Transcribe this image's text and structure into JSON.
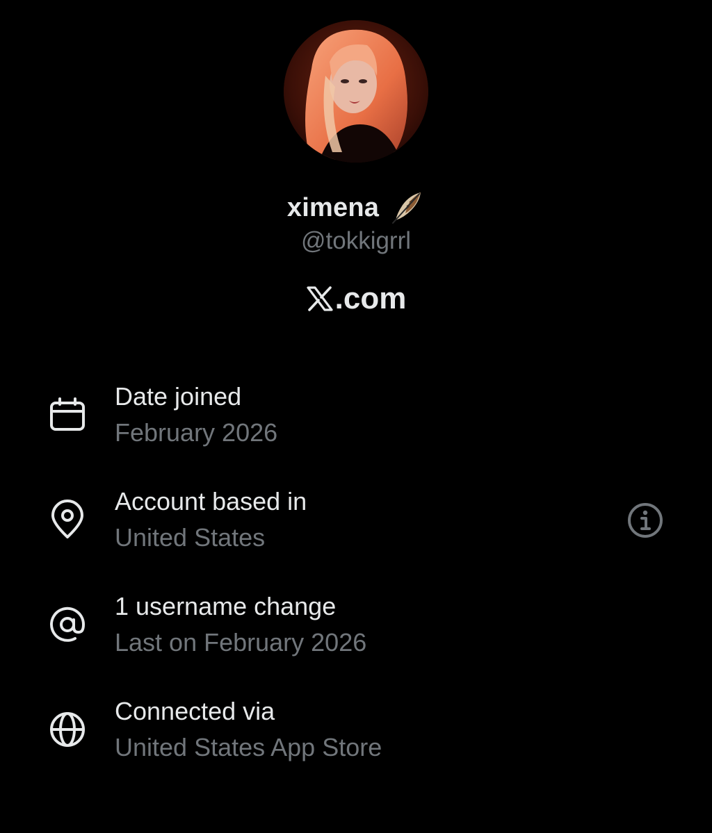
{
  "profile": {
    "display_name": "ximena",
    "display_name_emoji": "feather-emoji",
    "handle": "@tokkigrrl",
    "avatar": "profile-photo"
  },
  "brand": {
    "logo": "x-logo",
    "text": ".com"
  },
  "about": [
    {
      "icon": "calendar-icon",
      "label": "Date joined",
      "value": "February 2026"
    },
    {
      "icon": "location-pin-icon",
      "label": "Account based in",
      "value": "United States",
      "action_icon": "info-icon"
    },
    {
      "icon": "at-sign-icon",
      "label": "1 username change",
      "value": "Last on February 2026"
    },
    {
      "icon": "globe-icon",
      "label": "Connected via",
      "value": "United States App Store"
    }
  ],
  "colors": {
    "background": "#000000",
    "primary_text": "#e7e9ea",
    "secondary_text": "#71767b"
  }
}
